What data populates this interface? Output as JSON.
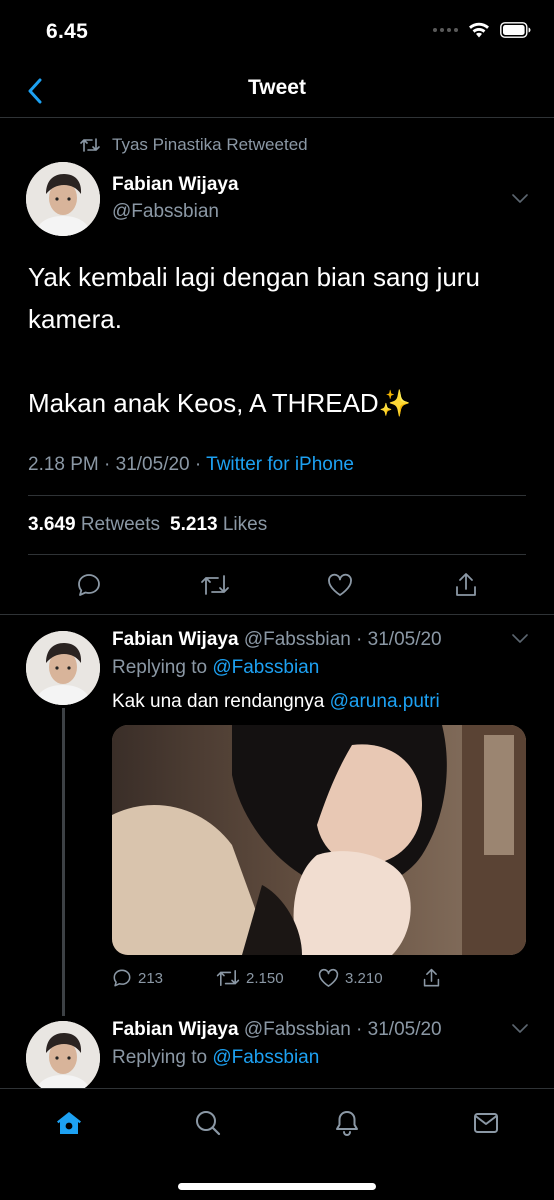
{
  "status_bar": {
    "time": "6.45"
  },
  "header": {
    "title": "Tweet"
  },
  "main_tweet": {
    "retweeted_by": "Tyas Pinastika Retweeted",
    "author_name": "Fabian Wijaya",
    "author_handle": "@Fabssbian",
    "text_line1": "Yak kembali lagi dengan bian sang juru kamera.",
    "text_line2": "Makan anak Keos, A THREAD✨",
    "timestamp": "2.18 PM · 31/05/20 · ",
    "source": "Twitter for iPhone",
    "retweets_count": "3.649",
    "retweets_label": "Retweets",
    "likes_count": "5.213",
    "likes_label": "Likes"
  },
  "replies": [
    {
      "author_name": "Fabian Wijaya",
      "handle_date": "@Fabssbian · 31/05/20",
      "replying_prefix": "Replying to ",
      "replying_to": "@Fabssbian",
      "text": "Kak una dan rendangnya ",
      "mention": "@aruna.putri",
      "reply_count": "213",
      "retweet_count": "2.150",
      "like_count": "3.210"
    },
    {
      "author_name": "Fabian Wijaya",
      "handle_date": "@Fabssbian · 31/05/20",
      "replying_prefix": "Replying to ",
      "replying_to": "@Fabssbian"
    }
  ],
  "colors": {
    "accent": "#1da1f2",
    "muted": "#8b98a5",
    "divider": "#2f3336",
    "background": "#000000"
  },
  "tabs": [
    "home-icon",
    "search-icon",
    "notifications-icon",
    "messages-icon"
  ]
}
